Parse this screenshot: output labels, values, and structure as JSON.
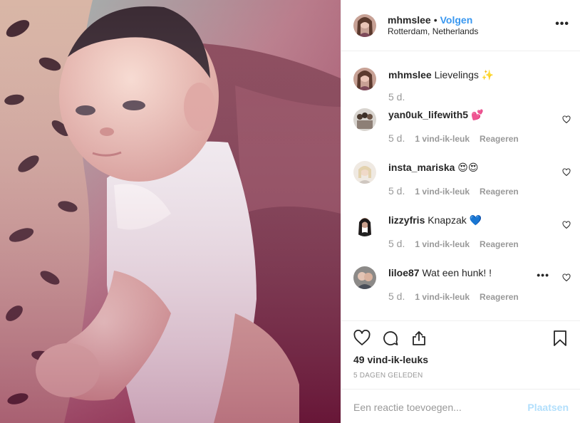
{
  "header": {
    "username": "mhmslee",
    "separator": "•",
    "follow_label": "Volgen",
    "location": "Rotterdam, Netherlands",
    "more_icon": "more-horizontal-icon"
  },
  "caption": {
    "username": "mhmslee",
    "text": "Lievelings ✨",
    "time": "5 d."
  },
  "comments": [
    {
      "username": "yan0uk_lifewith5",
      "text": "💕",
      "time": "5 d.",
      "likes": "1 vind-ik-leuk",
      "reply": "Reageren"
    },
    {
      "username": "insta_mariska",
      "text": "😍😍",
      "time": "5 d.",
      "likes": "1 vind-ik-leuk",
      "reply": "Reageren"
    },
    {
      "username": "lizzyfris",
      "text": "Knapzak 💙",
      "time": "5 d.",
      "likes": "1 vind-ik-leuk",
      "reply": "Reageren"
    },
    {
      "username": "liloe87",
      "text": "Wat een hunk! !",
      "time": "5 d.",
      "likes": "1 vind-ik-leuk",
      "reply": "Reageren"
    }
  ],
  "actions": {
    "like_icon": "heart-icon",
    "comment_icon": "comment-icon",
    "share_icon": "share-icon",
    "save_icon": "bookmark-icon",
    "likes_count": "49 vind-ik-leuks",
    "date": "5 DAGEN GELEDEN"
  },
  "add_comment": {
    "placeholder": "Een reactie toevoegen...",
    "post_label": "Plaatsen"
  },
  "colors": {
    "link_blue": "#3897f0",
    "post_disabled": "#b2dffc",
    "muted_gray": "#999999"
  }
}
